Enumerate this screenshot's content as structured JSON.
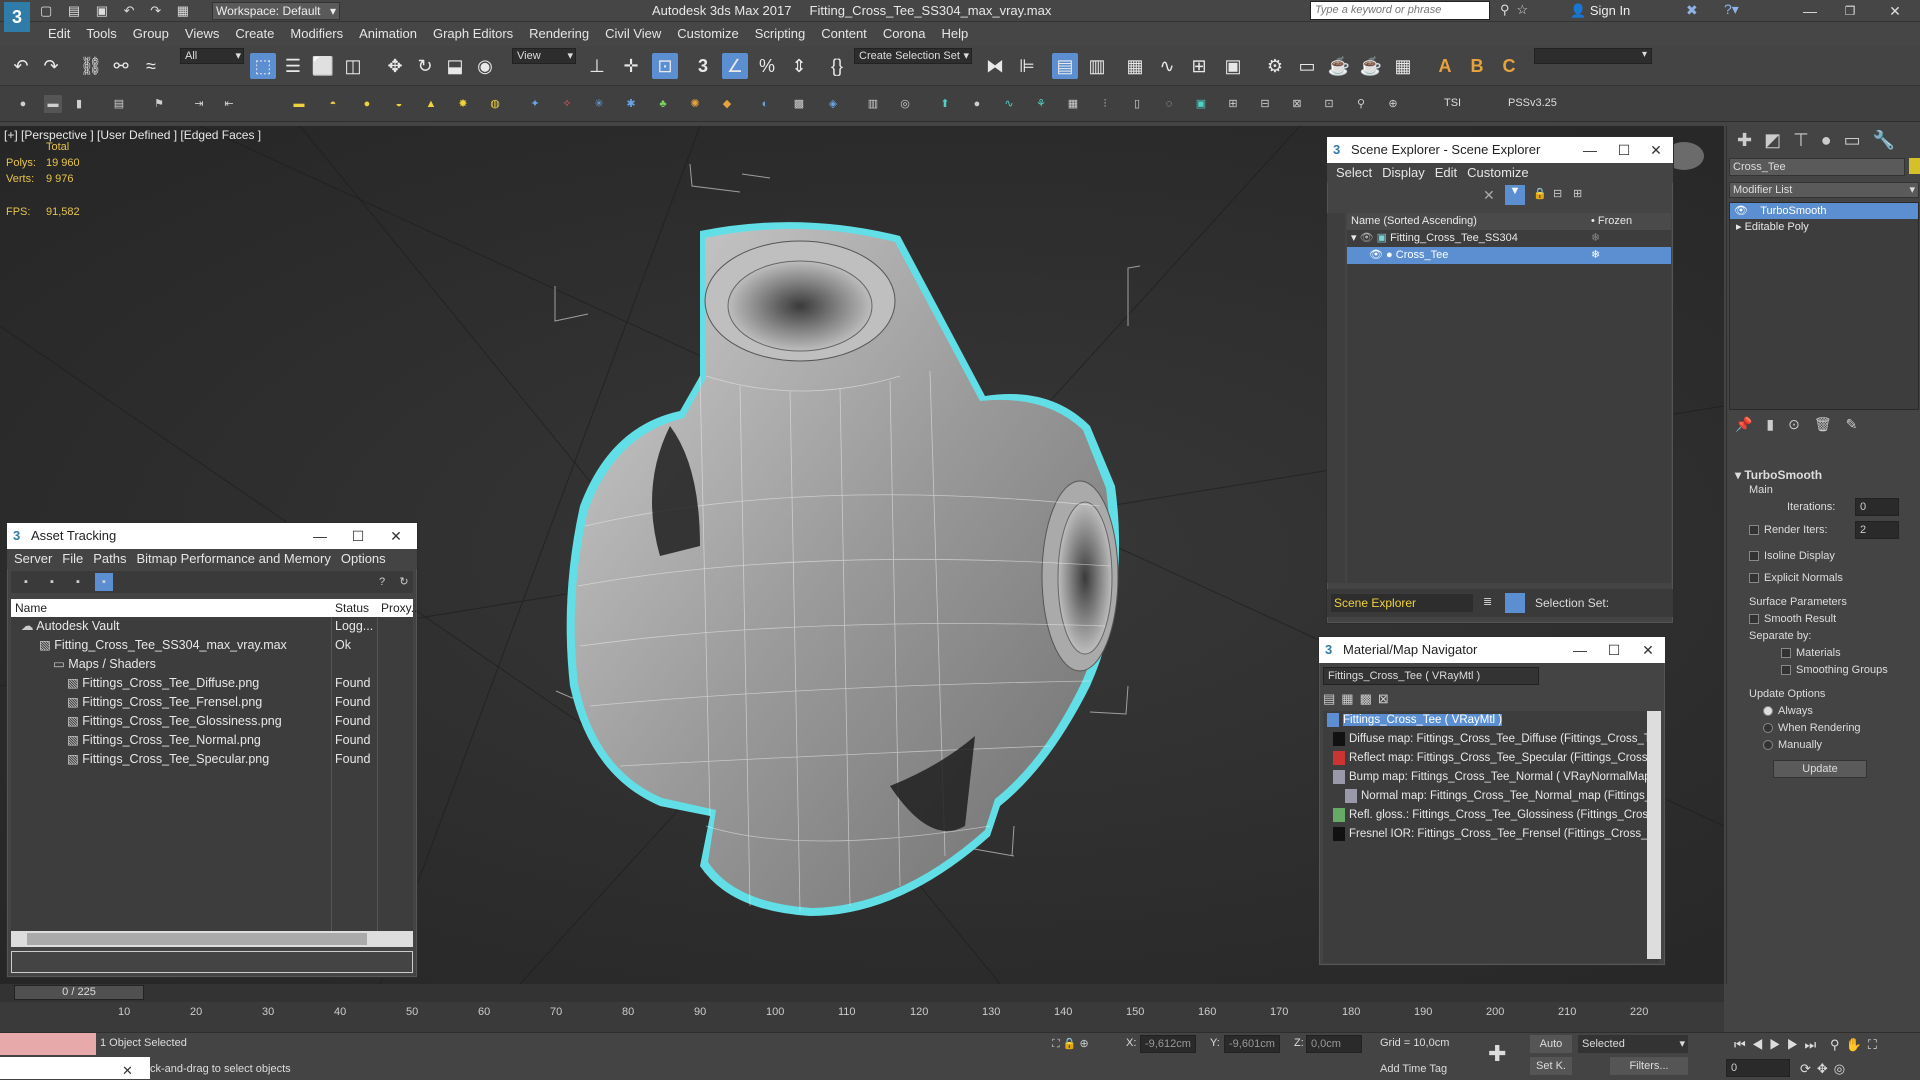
{
  "window": {
    "app_title": "Autodesk 3ds Max 2017",
    "file_title": "Fitting_Cross_Tee_SS304_max_vray.max",
    "workspace": "Workspace: Default",
    "search_placeholder": "Type a keyword or phrase",
    "sign_in": "Sign In"
  },
  "menus": [
    "Edit",
    "Tools",
    "Group",
    "Views",
    "Create",
    "Modifiers",
    "Animation",
    "Graph Editors",
    "Rendering",
    "Civil View",
    "Customize",
    "Scripting",
    "Content",
    "Corona",
    "Help"
  ],
  "toolbar": {
    "filter": "All",
    "ref_coord": "View",
    "selection_set": "Create Selection Set"
  },
  "toolbar2": {
    "tsi": "TSI",
    "pssv": "PSSv3.25"
  },
  "viewport": {
    "label": "[+] [Perspective ] [User Defined ] [Edged Faces ]",
    "total_label": "Total",
    "polys_label": "Polys:",
    "polys_value": "19 960",
    "verts_label": "Verts:",
    "verts_value": "9 976",
    "fps_label": "FPS:",
    "fps_value": "91,582"
  },
  "scene_explorer": {
    "title": "Scene Explorer - Scene Explorer",
    "menu": [
      "Select",
      "Display",
      "Edit",
      "Customize"
    ],
    "col_name": "Name (Sorted Ascending)",
    "col_frozen": "Frozen",
    "items": [
      {
        "name": "Fitting_Cross_Tee_SS304"
      },
      {
        "name": "Cross_Tee"
      }
    ],
    "footer_name": "Scene Explorer",
    "selection_set_label": "Selection Set:"
  },
  "asset_tracking": {
    "title": "Asset Tracking",
    "menu": [
      "Server",
      "File",
      "Paths",
      "Bitmap Performance and Memory",
      "Options"
    ],
    "col_name": "Name",
    "col_status": "Status",
    "col_proxy": "Proxy...",
    "rows": [
      {
        "name": "Autodesk Vault",
        "status": "Logg..."
      },
      {
        "name": "Fitting_Cross_Tee_SS304_max_vray.max",
        "status": "Ok"
      },
      {
        "name": "Maps / Shaders",
        "status": ""
      },
      {
        "name": "Fittings_Cross_Tee_Diffuse.png",
        "status": "Found"
      },
      {
        "name": "Fittings_Cross_Tee_Frensel.png",
        "status": "Found"
      },
      {
        "name": "Fittings_Cross_Tee_Glossiness.png",
        "status": "Found"
      },
      {
        "name": "Fittings_Cross_Tee_Normal.png",
        "status": "Found"
      },
      {
        "name": "Fittings_Cross_Tee_Specular.png",
        "status": "Found"
      }
    ]
  },
  "material_nav": {
    "title": "Material/Map Navigator",
    "current": "Fittings_Cross_Tee  ( VRayMtl )",
    "items": [
      "Fittings_Cross_Tee  ( VRayMtl )",
      "Diffuse map: Fittings_Cross_Tee_Diffuse (Fittings_Cross_Tee_",
      "Reflect map: Fittings_Cross_Tee_Specular (Fittings_Cross_Te",
      "Bump map: Fittings_Cross_Tee_Normal  ( VRayNormalMap )",
      "Normal map: Fittings_Cross_Tee_Normal_map (Fittings_Cro",
      "Refl. gloss.: Fittings_Cross_Tee_Glossiness (Fittings_Cross_Te",
      "Fresnel IOR: Fittings_Cross_Tee_Frensel (Fittings_Cross_Tee_"
    ]
  },
  "command_panel": {
    "object_name": "Cross_Tee",
    "modifier_list": "Modifier List",
    "stack": [
      "TurboSmooth",
      "Editable Poly"
    ],
    "rollout": "TurboSmooth",
    "main": "Main",
    "iterations_label": "Iterations:",
    "iterations": "0",
    "render_iters_label": "Render Iters:",
    "render_iters": "2",
    "isoline": "Isoline Display",
    "explicit_normals": "Explicit Normals",
    "surface_params": "Surface Parameters",
    "smooth_result": "Smooth Result",
    "separate_by": "Separate by:",
    "materials": "Materials",
    "smoothing_groups": "Smoothing Groups",
    "update_options": "Update Options",
    "always": "Always",
    "when_rendering": "When Rendering",
    "manually": "Manually",
    "update": "Update"
  },
  "timeline": {
    "frame": "0 / 225",
    "ticks": [
      "10",
      "20",
      "30",
      "40",
      "50",
      "60",
      "70",
      "80",
      "90",
      "100",
      "110",
      "120",
      "130",
      "140",
      "150",
      "160",
      "170",
      "180",
      "190",
      "200",
      "210",
      "220"
    ]
  },
  "status": {
    "selected": "1 Object Selected",
    "prompt": "ck-and-drag to select objects",
    "x_label": "X:",
    "x": "-9,612cm",
    "y_label": "Y:",
    "y": "-9,601cm",
    "z_label": "Z:",
    "z": "0,0cm",
    "grid": "Grid = 10,0cm",
    "add_time_tag": "Add Time Tag",
    "auto": "Auto",
    "set_key": "Set K.",
    "sel_mode": "Selected",
    "filters": "Filters...",
    "frame_field": "0"
  }
}
